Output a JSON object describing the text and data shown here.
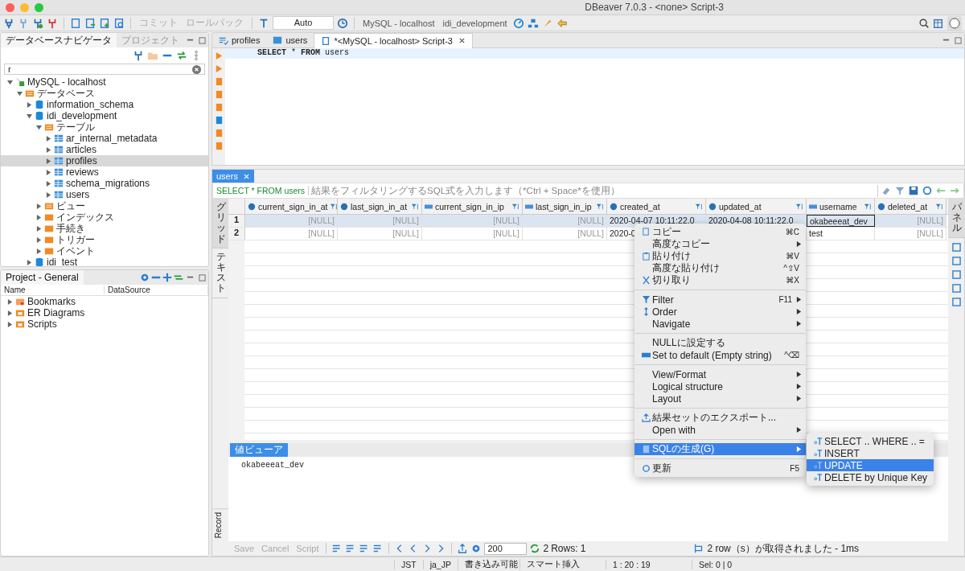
{
  "window": {
    "title": "DBeaver 7.0.3 - <none> Script-3"
  },
  "toolbar": {
    "transaction_buttons": [
      {
        "label": "コミット",
        "disabled": true
      },
      {
        "label": "ロールバック",
        "disabled": true
      }
    ],
    "mode": "Auto",
    "connection": "MySQL - localhost",
    "database": "idi_development"
  },
  "navigator": {
    "tabs": [
      {
        "label": "データベースナビゲータ",
        "selected": true
      },
      {
        "label": "プロジェクト",
        "selected": false
      }
    ],
    "filter": "r",
    "tree": [
      {
        "label": "MySQL - localhost",
        "kind": "connection",
        "expanded": true,
        "selected": false,
        "children": [
          {
            "label": "データベース",
            "kind": "db-folder",
            "expanded": true,
            "selected": false,
            "children": [
              {
                "label": "information_schema",
                "kind": "database",
                "expanded": false,
                "selected": false
              },
              {
                "label": "idi_development",
                "kind": "database",
                "expanded": true,
                "selected": false,
                "children": [
                  {
                    "label": "テーブル",
                    "kind": "table-folder",
                    "expanded": true,
                    "selected": false,
                    "children": [
                      {
                        "label": "ar_internal_metadata",
                        "kind": "table",
                        "expanded": false,
                        "selected": false
                      },
                      {
                        "label": "articles",
                        "kind": "table",
                        "expanded": false,
                        "selected": false
                      },
                      {
                        "label": "profiles",
                        "kind": "table",
                        "expanded": false,
                        "selected": true
                      },
                      {
                        "label": "reviews",
                        "kind": "table",
                        "expanded": false,
                        "selected": false
                      },
                      {
                        "label": "schema_migrations",
                        "kind": "table",
                        "expanded": false,
                        "selected": false
                      },
                      {
                        "label": "users",
                        "kind": "table",
                        "expanded": false,
                        "selected": false
                      }
                    ]
                  },
                  {
                    "label": "ビュー",
                    "kind": "view-folder",
                    "expanded": false,
                    "selected": false
                  },
                  {
                    "label": "インデックス",
                    "kind": "folder",
                    "expanded": false,
                    "selected": false
                  },
                  {
                    "label": "手続き",
                    "kind": "folder",
                    "expanded": false,
                    "selected": false
                  },
                  {
                    "label": "トリガー",
                    "kind": "folder",
                    "expanded": false,
                    "selected": false
                  },
                  {
                    "label": "イベント",
                    "kind": "folder",
                    "expanded": false,
                    "selected": false
                  }
                ]
              },
              {
                "label": "idi_test",
                "kind": "database",
                "expanded": false,
                "selected": false
              }
            ]
          }
        ]
      }
    ]
  },
  "project": {
    "title": "Project - General",
    "columns": [
      "Name",
      "DataSource"
    ],
    "items": [
      {
        "label": "Bookmarks",
        "kind": "bookmarks"
      },
      {
        "label": "ER Diagrams",
        "kind": "diagrams"
      },
      {
        "label": "Scripts",
        "kind": "scripts"
      }
    ]
  },
  "editor": {
    "tabs": [
      {
        "label": "profiles",
        "kind": "properties",
        "selected": false
      },
      {
        "label": "users",
        "kind": "table",
        "selected": false
      },
      {
        "label": "*<MySQL - localhost> Script-3",
        "kind": "script",
        "selected": true
      }
    ],
    "sql": "**SELECT** * **FROM** users"
  },
  "results": {
    "tab": "users",
    "query": "SELECT * FROM users",
    "filter_placeholder": "結果をフィルタリングするSQL式を入力します（*Ctrl + Space*を使用）",
    "side_tabs": [
      {
        "label": "グリッド",
        "kind": "cjk",
        "selected": true
      },
      {
        "label": "テキスト",
        "kind": "cjk",
        "selected": false
      },
      {
        "label": "Record",
        "kind": "latin",
        "selected": false
      }
    ],
    "right_tab": "パネル",
    "columns": [
      {
        "name": "current_sign_in_at",
        "kind": "date"
      },
      {
        "name": "last_sign_in_at",
        "kind": "date"
      },
      {
        "name": "current_sign_in_ip",
        "kind": "text"
      },
      {
        "name": "last_sign_in_ip",
        "kind": "text"
      },
      {
        "name": "created_at",
        "kind": "date"
      },
      {
        "name": "updated_at",
        "kind": "date"
      },
      {
        "name": "username",
        "kind": "text"
      },
      {
        "name": "deleted_at",
        "kind": "date"
      }
    ],
    "rows": [
      {
        "number": "1",
        "selected": true,
        "cells": [
          {
            "text": "[NULL]",
            "is_null": true,
            "focused": false
          },
          {
            "text": "[NULL]",
            "is_null": true,
            "focused": false
          },
          {
            "text": "[NULL]",
            "is_null": true,
            "focused": false
          },
          {
            "text": "[NULL]",
            "is_null": true,
            "focused": false
          },
          {
            "text": "2020-04-07 10:11:22.0",
            "is_null": false,
            "focused": false
          },
          {
            "text": "2020-04-08 10:11:22.0",
            "is_null": false,
            "focused": false
          },
          {
            "text": "okabeeeat_dev",
            "is_null": false,
            "focused": true
          },
          {
            "text": "[NULL]",
            "is_null": true,
            "focused": false
          }
        ]
      },
      {
        "number": "2",
        "selected": false,
        "cells": [
          {
            "text": "[NULL]",
            "is_null": true,
            "focused": false
          },
          {
            "text": "[NULL]",
            "is_null": true,
            "focused": false
          },
          {
            "text": "[NULL]",
            "is_null": true,
            "focused": false
          },
          {
            "text": "[NULL]",
            "is_null": true,
            "focused": false
          },
          {
            "text": "2020-0",
            "is_null": false,
            "focused": false
          },
          null,
          {
            "text": "test",
            "is_null": false,
            "focused": false
          },
          {
            "text": "[NULL]",
            "is_null": true,
            "focused": false
          }
        ]
      }
    ],
    "value_viewer": {
      "tab": "値ビューア",
      "value": "okabeeeat_dev"
    },
    "bottom_buttons": [
      {
        "label": "Save",
        "disabled": true
      },
      {
        "label": "Cancel",
        "disabled": true
      },
      {
        "label": "Script",
        "disabled": true
      }
    ],
    "fetch_size": "200",
    "fetch_count": "2",
    "rows_label": "Rows: 1",
    "fetch_status": "2 row（s）が取得されました - 1ms"
  },
  "context_menu": {
    "groups": [
      [
        {
          "label": "コピー",
          "kind": "copy",
          "shortcut": "⌘C",
          "submenu": false,
          "selected": false
        },
        {
          "label": "高度なコピー",
          "submenu": true,
          "selected": false
        },
        {
          "label": "貼り付け",
          "kind": "paste",
          "shortcut": "⌘V",
          "submenu": false,
          "selected": false
        },
        {
          "label": "高度な貼り付け",
          "shortcut": "^⇧V",
          "submenu": false,
          "selected": false
        },
        {
          "label": "切り取り",
          "kind": "cut",
          "shortcut": "⌘X",
          "submenu": false,
          "selected": false
        }
      ],
      [
        {
          "label": "Filter",
          "kind": "filter",
          "shortcut": "F11",
          "submenu": true,
          "selected": false
        },
        {
          "label": "Order",
          "kind": "order",
          "submenu": true,
          "selected": false
        },
        {
          "label": "Navigate",
          "submenu": true,
          "selected": false
        }
      ],
      [
        {
          "label": "NULLに設定する",
          "submenu": false,
          "selected": false
        },
        {
          "label": "Set to default (Empty string)",
          "kind": "abc",
          "shortcut": "^⌫",
          "submenu": false,
          "selected": false
        }
      ],
      [
        {
          "label": "View/Format",
          "submenu": true,
          "selected": false
        },
        {
          "label": "Logical structure",
          "submenu": true,
          "selected": false
        },
        {
          "label": "Layout",
          "submenu": true,
          "selected": false
        }
      ],
      [
        {
          "label": "結果セットのエクスポート...",
          "kind": "export",
          "submenu": false,
          "selected": false
        },
        {
          "label": "Open with",
          "submenu": true,
          "selected": false
        }
      ],
      [
        {
          "label": "SQLの生成(G)",
          "kind": "sql",
          "submenu": true,
          "selected": true
        }
      ],
      [
        {
          "label": "更新",
          "kind": "refresh",
          "shortcut": "F5",
          "submenu": false,
          "selected": false
        }
      ]
    ],
    "submenu": [
      {
        "label": "SELECT .. WHERE .. =",
        "selected": false
      },
      {
        "label": "INSERT",
        "selected": false
      },
      {
        "label": "UPDATE",
        "selected": true
      },
      {
        "label": "DELETE by Unique Key",
        "selected": false
      }
    ]
  },
  "status_bar": [
    "JST",
    "ja_JP",
    "書き込み可能",
    "スマート挿入",
    "1 : 20 : 19",
    "Sel: 0 | 0"
  ]
}
